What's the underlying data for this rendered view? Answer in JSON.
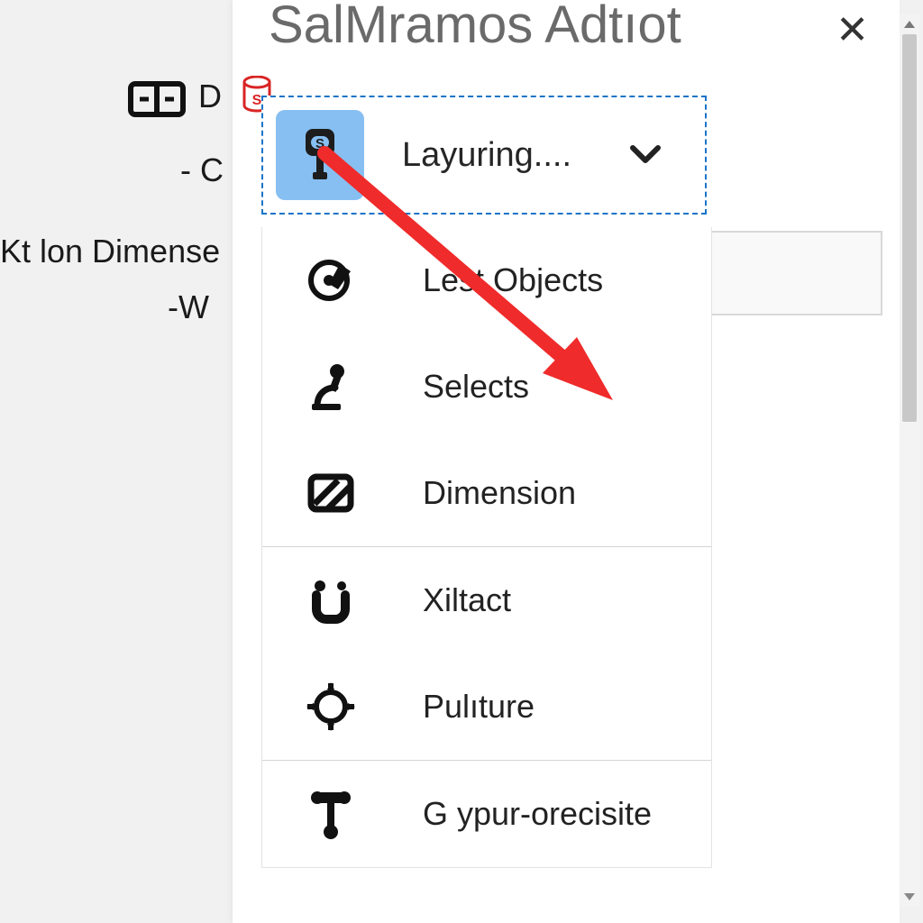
{
  "background": {
    "frag1": "D",
    "frag2": "- C",
    "frag3": "Kt lon Dimense",
    "frag4": "-W"
  },
  "panel": {
    "title": "SalMramos Adtıot",
    "close_label": "✕"
  },
  "combo": {
    "label": "Layuring....",
    "icon_name": "stamp-icon"
  },
  "menu": {
    "groups": [
      {
        "items": [
          {
            "icon": "target-edit-icon",
            "label": "Lest Objects"
          },
          {
            "icon": "microscope-icon",
            "label": "Selects"
          },
          {
            "icon": "hatch-icon",
            "label": "Dimension"
          }
        ]
      },
      {
        "items": [
          {
            "icon": "u-dots-icon",
            "label": "Xiltact"
          },
          {
            "icon": "reticle-icon",
            "label": "Pulıture"
          }
        ]
      },
      {
        "items": [
          {
            "icon": "hammer-icon",
            "label": "G ypur-orecisite"
          }
        ]
      }
    ]
  },
  "annotation": {
    "color": "#ef2b2b"
  },
  "icon_glyphs": {
    "chevron_down": "⌄"
  }
}
